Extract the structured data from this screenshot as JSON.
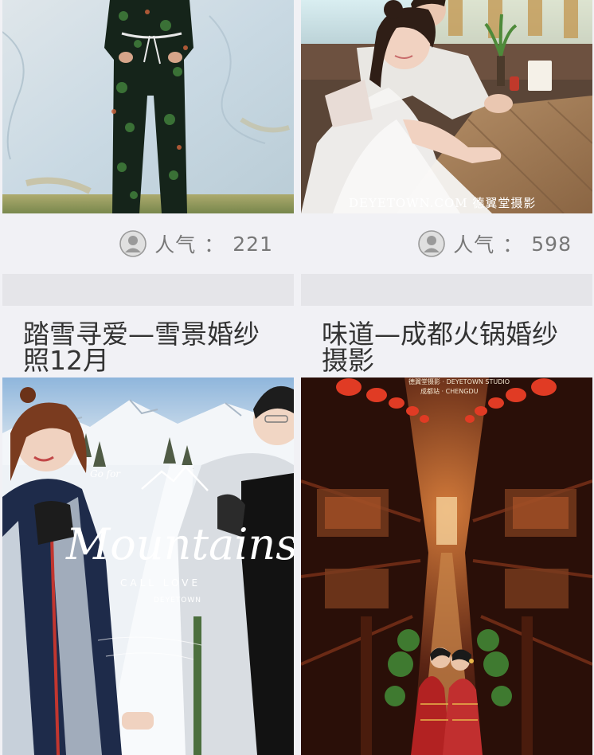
{
  "cards": [
    {
      "popularity_label": "人气",
      "popularity_sep": "：",
      "popularity_value": "221",
      "icon": "avatar-icon"
    },
    {
      "popularity_label": "人气",
      "popularity_sep": "：",
      "popularity_value": "598",
      "icon": "avatar-icon",
      "watermark": "DEYETOWN.COM 德翼堂摄影"
    },
    {
      "title": "踏雪寻爱—雪景婚纱照12月",
      "overlay_script": "Mountains",
      "overlay_small": "CALL LOVE",
      "overlay_tag": "DEYETOWN"
    },
    {
      "title": "味道—成都火锅婚纱摄影",
      "header_line1": "德翼堂摄影 · DEYETOWN STUDIO",
      "header_line2": "成都站 · CHENGDU"
    }
  ]
}
